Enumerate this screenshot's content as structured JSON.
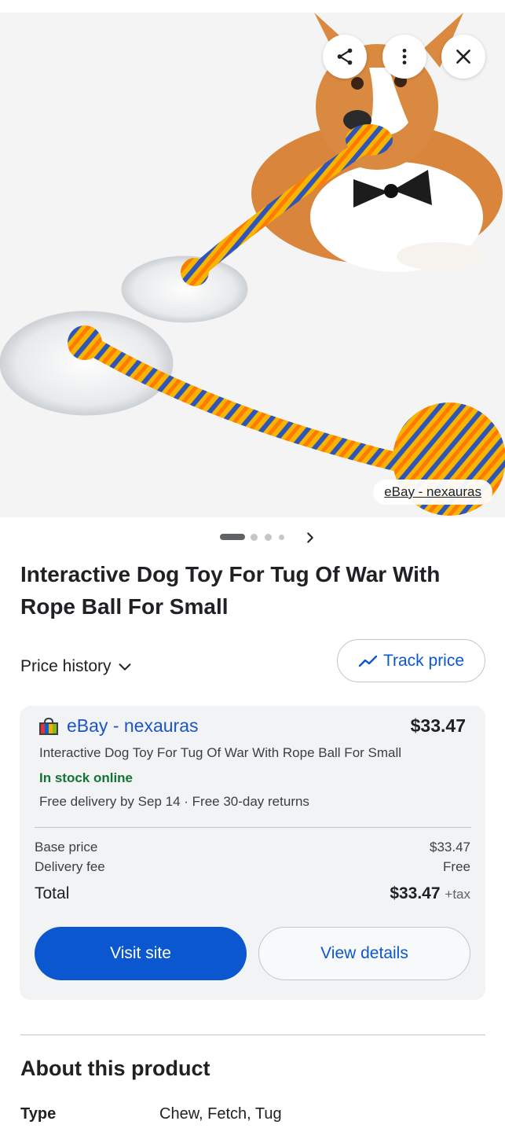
{
  "image": {
    "source_chip": "eBay - nexauras",
    "actions": {
      "share_icon": "share-icon",
      "more_icon": "more-vert-icon",
      "close_icon": "close-icon"
    },
    "carousel": {
      "total_indicators": 4,
      "active_index": 0
    }
  },
  "product": {
    "title": "Interactive Dog Toy For Tug Of War With Rope Ball For Small"
  },
  "price_history": {
    "label": "Price history",
    "track_label": "Track price"
  },
  "offer": {
    "merchant": "eBay - nexauras",
    "price": "$33.47",
    "description": "Interactive Dog Toy For Tug Of War With Rope Ball For Small",
    "stock": "In stock online",
    "delivery": "Free delivery by Sep 14 · Free 30-day returns",
    "base_price_label": "Base price",
    "base_price_value": "$33.47",
    "delivery_fee_label": "Delivery fee",
    "delivery_fee_value": "Free",
    "total_label": "Total",
    "total_value": "$33.47",
    "total_suffix": "+tax",
    "visit_label": "Visit site",
    "details_label": "View details"
  },
  "about": {
    "title": "About this product",
    "attributes": [
      {
        "label": "Type",
        "value": "Chew, Fetch, Tug"
      }
    ]
  },
  "colors": {
    "accent_blue": "#0b57d0",
    "stock_green": "#137333",
    "card_bg": "#f1f3f4"
  }
}
